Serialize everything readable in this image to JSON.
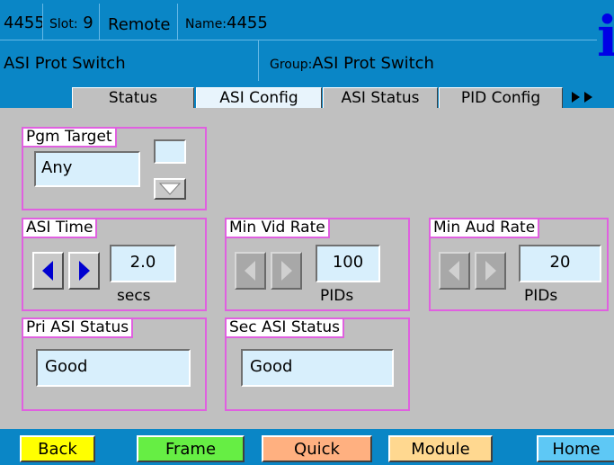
{
  "header": {
    "frame_id": "4455",
    "slot_label": "Slot:",
    "slot_value": "9",
    "mode": "Remote",
    "name_label": "Name:",
    "name_value": "4455",
    "card_title": "ASI Prot Switch",
    "group_label": "Group:",
    "group_value": "ASI Prot Switch",
    "info_glyph": "i"
  },
  "tabs": [
    {
      "label": "Status",
      "selected": false
    },
    {
      "label": "ASI Config",
      "selected": true
    },
    {
      "label": "ASI Status",
      "selected": false
    },
    {
      "label": "PID Config",
      "selected": false
    }
  ],
  "tabs_more_icon": "double-right-arrow-icon",
  "pgm_target": {
    "legend": "Pgm Target",
    "value": "Any",
    "icon": "dropdown-arrow-icon"
  },
  "asi_time": {
    "legend": "ASI Time",
    "value": "2.0",
    "unit": "secs"
  },
  "min_vid_rate": {
    "legend": "Min Vid Rate",
    "value": "100",
    "unit": "PIDs"
  },
  "min_aud_rate": {
    "legend": "Min Aud Rate",
    "value": "20",
    "unit": "PIDs"
  },
  "pri_asi_status": {
    "legend": "Pri ASI Status",
    "value": "Good"
  },
  "sec_asi_status": {
    "legend": "Sec ASI Status",
    "value": "Good"
  },
  "footer": {
    "back": "Back",
    "frame": "Frame",
    "quick": "Quick",
    "module": "Module",
    "home": "Home"
  },
  "colors": {
    "header_blue": "#0a86c6",
    "group_border": "#e060e0",
    "field_bg": "#d8effc",
    "back_button": "#ffff00",
    "frame_button": "#66ee44",
    "quick_button": "#ffb080",
    "module_button": "#ffd890",
    "home_button": "#5ec8f5"
  }
}
